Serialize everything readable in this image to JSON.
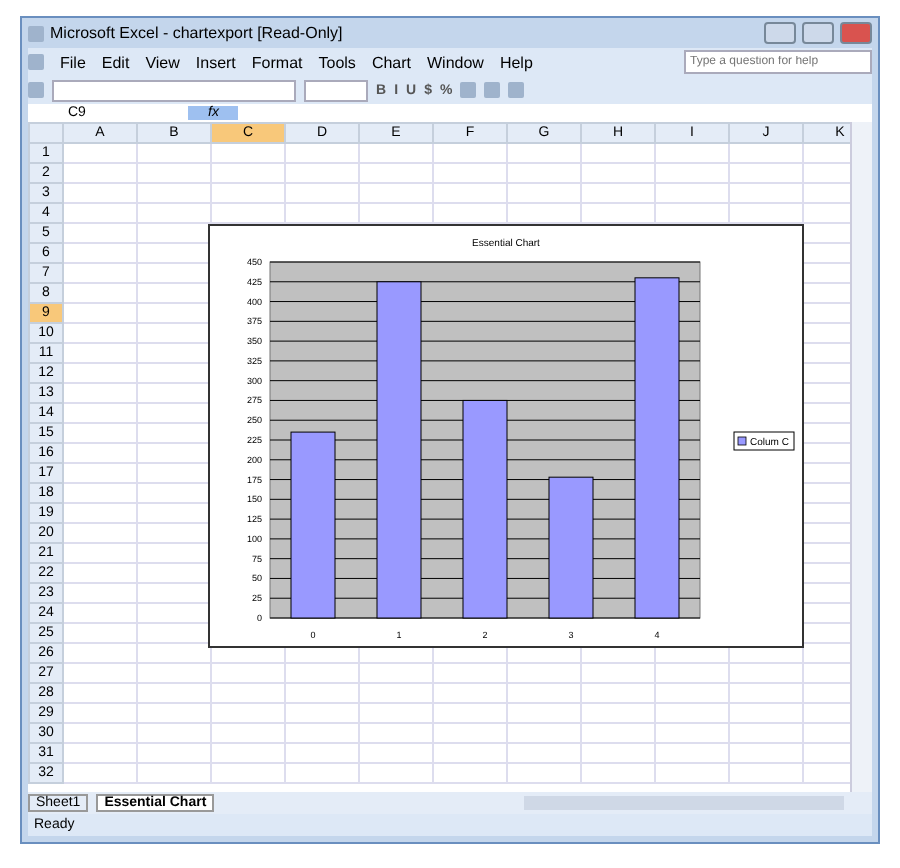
{
  "window": {
    "title": "Microsoft Excel - chartexport  [Read-Only]"
  },
  "menu": [
    "File",
    "Edit",
    "View",
    "Insert",
    "Format",
    "Tools",
    "Chart",
    "Window",
    "Help"
  ],
  "help_box": {
    "placeholder": "Type a question for help"
  },
  "format_buttons": [
    "B",
    "I",
    "U",
    "$",
    "%"
  ],
  "name_box": "C9",
  "formula_bar": {
    "fx_label": "fx"
  },
  "columns": [
    {
      "label": "A",
      "selected": false
    },
    {
      "label": "B",
      "selected": false
    },
    {
      "label": "C",
      "selected": true
    },
    {
      "label": "D",
      "selected": false
    },
    {
      "label": "E",
      "selected": false
    },
    {
      "label": "F",
      "selected": false
    },
    {
      "label": "G",
      "selected": false
    },
    {
      "label": "H",
      "selected": false
    },
    {
      "label": "I",
      "selected": false
    },
    {
      "label": "J",
      "selected": false
    },
    {
      "label": "K",
      "selected": false
    }
  ],
  "rows": [
    {
      "label": "1",
      "selected": false
    },
    {
      "label": "2",
      "selected": false
    },
    {
      "label": "3",
      "selected": false
    },
    {
      "label": "4",
      "selected": false
    },
    {
      "label": "5",
      "selected": false
    },
    {
      "label": "6",
      "selected": false
    },
    {
      "label": "7",
      "selected": false
    },
    {
      "label": "8",
      "selected": false
    },
    {
      "label": "9",
      "selected": true
    },
    {
      "label": "10",
      "selected": false
    },
    {
      "label": "11",
      "selected": false
    },
    {
      "label": "12",
      "selected": false
    },
    {
      "label": "13",
      "selected": false
    },
    {
      "label": "14",
      "selected": false
    },
    {
      "label": "15",
      "selected": false
    },
    {
      "label": "16",
      "selected": false
    },
    {
      "label": "17",
      "selected": false
    },
    {
      "label": "18",
      "selected": false
    },
    {
      "label": "19",
      "selected": false
    },
    {
      "label": "20",
      "selected": false
    },
    {
      "label": "21",
      "selected": false
    },
    {
      "label": "22",
      "selected": false
    },
    {
      "label": "23",
      "selected": false
    },
    {
      "label": "24",
      "selected": false
    },
    {
      "label": "25",
      "selected": false
    },
    {
      "label": "26",
      "selected": false
    },
    {
      "label": "27",
      "selected": false
    },
    {
      "label": "28",
      "selected": false
    },
    {
      "label": "29",
      "selected": false
    },
    {
      "label": "30",
      "selected": false
    },
    {
      "label": "31",
      "selected": false
    },
    {
      "label": "32",
      "selected": false
    }
  ],
  "chart": {
    "chart_data": {
      "type": "bar",
      "title": "Essential Chart",
      "grid": true,
      "categories": [
        "0",
        "1",
        "2",
        "3",
        "4"
      ],
      "series": [
        {
          "name": "Colum C",
          "color": "#9999ff",
          "values": [
            235,
            425,
            275,
            178,
            430
          ]
        }
      ],
      "ylim": [
        0,
        450
      ],
      "yticks": [
        0,
        25,
        50,
        75,
        100,
        125,
        150,
        175,
        200,
        225,
        250,
        275,
        300,
        325,
        350,
        375,
        400,
        425,
        450
      ]
    }
  },
  "sheet_tabs": [
    {
      "label": "Sheet1",
      "selected": false
    },
    {
      "label": "Essential Chart",
      "selected": true
    }
  ],
  "status": "Ready"
}
